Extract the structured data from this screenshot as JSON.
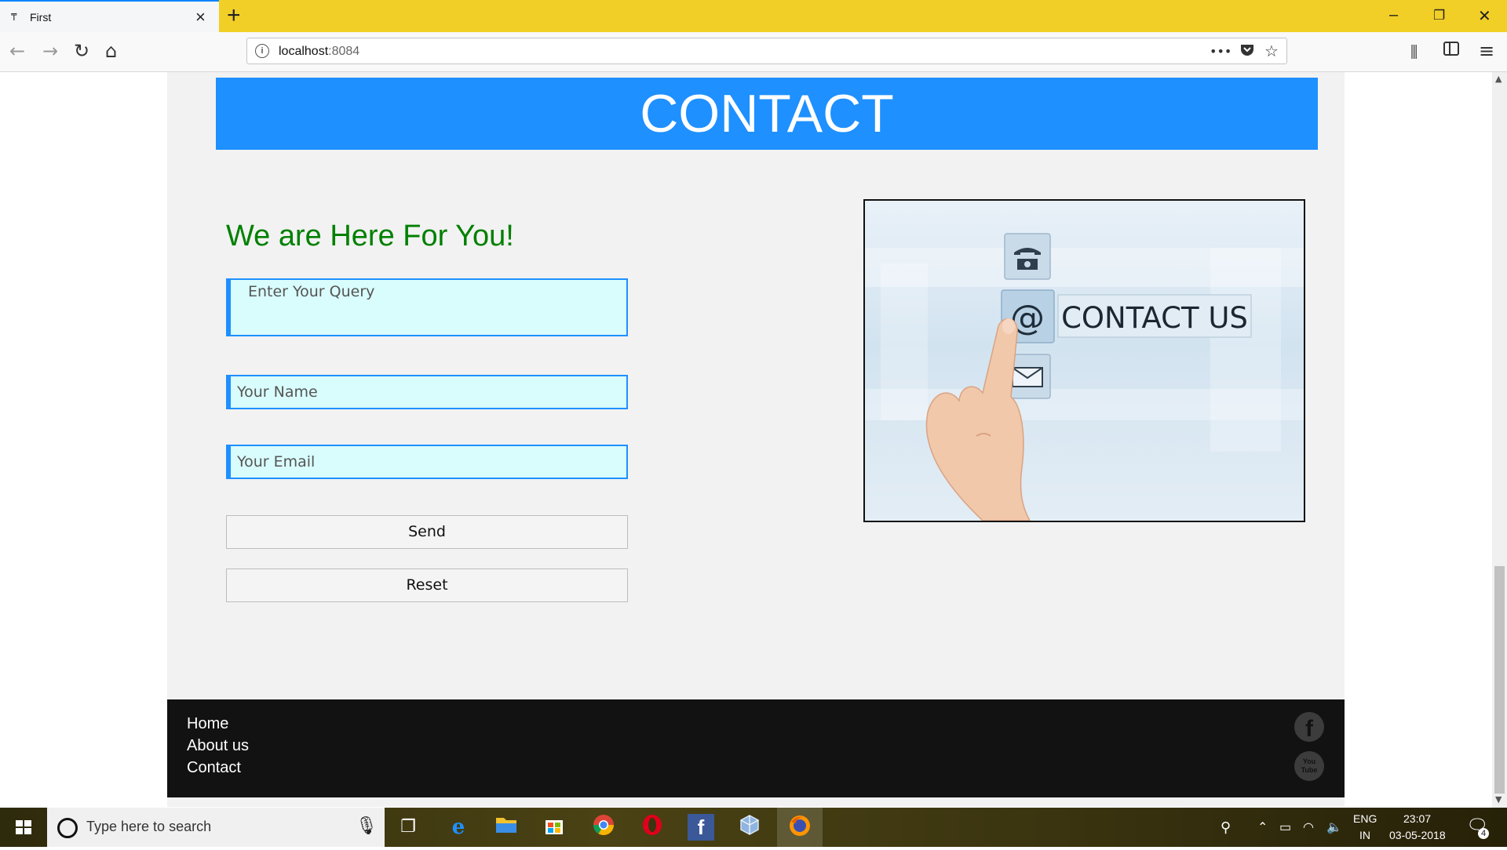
{
  "browser": {
    "tab_title": "First",
    "tab_favicon": "tab-favicon",
    "tab_close": "×",
    "new_tab": "+",
    "window_minimize": "–",
    "window_restore": "❐",
    "window_close": "✕",
    "url_host": "localhost",
    "url_port": ":8084",
    "page_actions": "•••"
  },
  "page": {
    "banner_title": "CONTACT",
    "heading": "We are Here For You!",
    "form": {
      "query_placeholder": "Enter Your Query",
      "name_placeholder": "Your Name",
      "email_placeholder": "Your Email",
      "send_label": "Send",
      "reset_label": "Reset"
    },
    "image": {
      "overlay_text": "CONTACT US",
      "at_symbol": "@"
    },
    "footer": {
      "links": [
        "Home",
        "About us",
        "Contact"
      ],
      "social": [
        "facebook-icon",
        "youtube-icon"
      ],
      "facebook_glyph": "f",
      "youtube_glyph": "You Tube"
    },
    "colors": {
      "banner": "#1e90ff",
      "heading": "#008000",
      "field_bg": "#d9fcfc",
      "footer_bg": "#121212",
      "tabbar": "#f2cf26"
    }
  },
  "taskbar": {
    "search_placeholder": "Type here to search",
    "language": "ENG",
    "region": "IN",
    "time": "23:07",
    "date": "03-05-2018",
    "notification_count": "4"
  }
}
